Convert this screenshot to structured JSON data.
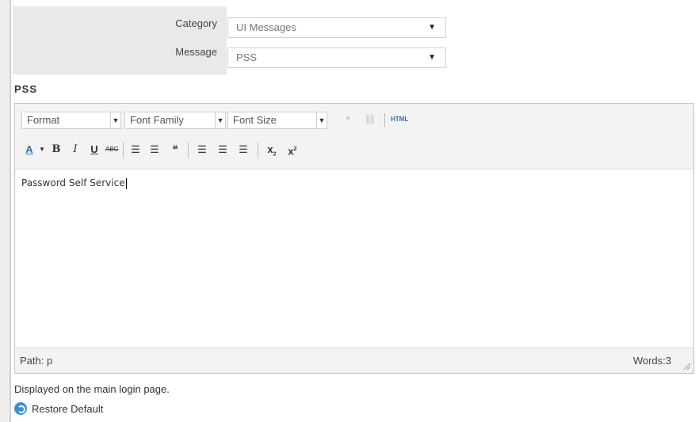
{
  "form": {
    "category_label": "Category",
    "category_value": "UI Messages",
    "message_label": "Message",
    "message_value": "PSS"
  },
  "message_name": "PSS",
  "toolbar": {
    "format": "Format",
    "font_family": "Font Family",
    "font_size": "Font Size",
    "html_label": "HTML"
  },
  "editor": {
    "content": "Password Self Service",
    "path": "Path: p",
    "words": "Words:3"
  },
  "description": "Displayed on the main login page.",
  "restore_label": "Restore Default"
}
